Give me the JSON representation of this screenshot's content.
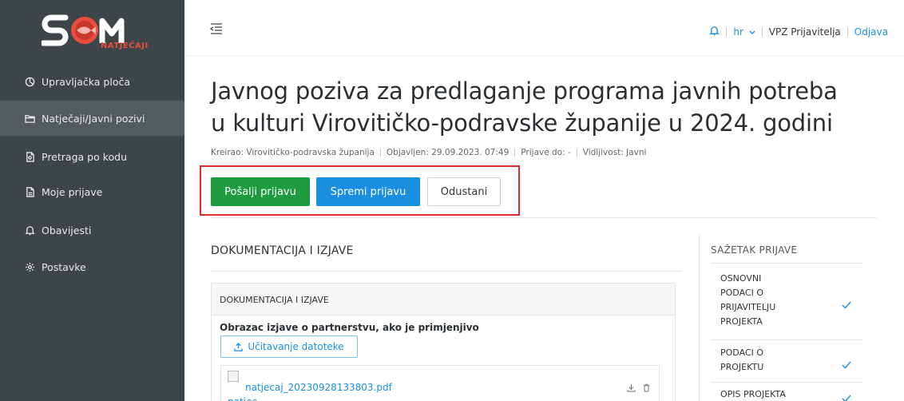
{
  "brand": {
    "logo_text": "NATJEČAJI",
    "logo_name": "som-logo"
  },
  "sidebar": {
    "items": [
      {
        "label": "Upravljačka ploča",
        "icon": "dashboard-icon"
      },
      {
        "label": "Natječaji/Javni pozivi",
        "icon": "folder-icon",
        "active": true
      },
      {
        "label": "Pretraga po kodu",
        "icon": "file-search-icon"
      },
      {
        "label": "Moje prijave",
        "icon": "document-icon"
      },
      {
        "label": "Obavijesti",
        "icon": "bell-icon"
      },
      {
        "label": "Postavke",
        "icon": "gear-icon"
      }
    ]
  },
  "header": {
    "language": "hr",
    "user": "VPZ Prijavitelja",
    "logout": "Odjava"
  },
  "page": {
    "title_line1": "Javnog poziva za predlaganje programa javnih potreba",
    "title_line2": "u kulturi Virovitičko-podravske županije u 2024. godini",
    "meta": {
      "creator": "Kreirao: Virovitičko-podravska županija",
      "published": "Objavljen: 29.09.2023. 07:49",
      "deadline": "Prijave do: -",
      "visibility": "Vidljivost: Javni"
    }
  },
  "actions": {
    "send": "Pošalji prijavu",
    "save": "Spremi prijavu",
    "cancel": "Odustani"
  },
  "main": {
    "section_title": "DOKUMENTACIJA I IZJAVE",
    "card_title": "DOKUMENTACIJA I IZJAVE",
    "field_label": "Obrazac izjave o partnerstvu, ako je primjenjivo",
    "upload_label": "Učitavanje datoteke",
    "file_name": "natjecaj_20230928133803.pdf",
    "file_name_partial": "natjec"
  },
  "summary": {
    "title": "SAŽETAK PRIJAVE",
    "items": [
      {
        "line1": "OSNOVNI",
        "line2": "PODACI O",
        "line3": "PRIJAVITELJU",
        "line4": "PROJEKTA",
        "done": true
      },
      {
        "line1": "PODACI O",
        "line2": "PROJEKTU",
        "done": true
      },
      {
        "line1": "OPIS PROJEKTA",
        "done": true
      }
    ]
  },
  "colors": {
    "sidebar_bg": "#3d4548",
    "sidebar_active": "#535b5e",
    "primary": "#1a8fe0",
    "success": "#1f9b3f",
    "highlight": "#e02b35"
  }
}
